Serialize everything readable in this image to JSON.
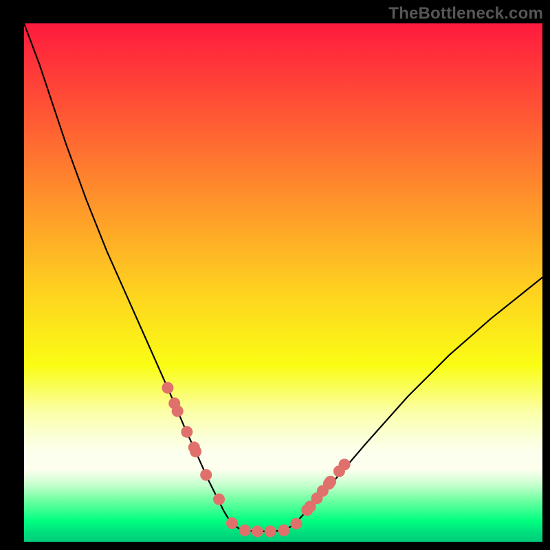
{
  "watermark": "TheBottleneck.com",
  "chart_data": {
    "type": "line",
    "title": "",
    "xlabel": "",
    "ylabel": "",
    "xlim": [
      0,
      100
    ],
    "ylim": [
      0,
      100
    ],
    "background_gradient": [
      "#ff1a3e",
      "#fafd14",
      "#00cc7a"
    ],
    "series": [
      {
        "name": "bottleneck-curve",
        "x": [
          0,
          3,
          5,
          8,
          12,
          16,
          20,
          24,
          28,
          31,
          33.5,
          35.5,
          37,
          38.5,
          40,
          42,
          45,
          48,
          50,
          52,
          55,
          60,
          66,
          74,
          82,
          90,
          100
        ],
        "y": [
          100,
          92,
          86,
          77,
          66,
          56,
          47,
          38,
          29,
          22,
          16.5,
          12,
          9,
          6,
          3.5,
          2.2,
          2,
          2,
          2.2,
          3.2,
          6.5,
          12,
          19,
          28,
          36,
          43,
          51
        ]
      }
    ],
    "markers": {
      "name": "highlighted-points",
      "x": [
        27.7,
        29.0,
        29.6,
        31.4,
        32.8,
        33.1,
        35.1,
        37.6,
        40.1,
        42.6,
        45.0,
        47.5,
        50.1,
        52.5,
        54.6,
        55.2,
        56.5,
        57.6,
        58.8,
        59.1,
        60.8,
        61.8
      ],
      "y": [
        29.7,
        26.7,
        25.2,
        21.2,
        18.2,
        17.4,
        12.9,
        8.2,
        3.6,
        2.2,
        2.0,
        2.0,
        2.2,
        3.5,
        6.1,
        6.8,
        8.4,
        9.8,
        11.2,
        11.6,
        13.6,
        14.9
      ]
    }
  }
}
